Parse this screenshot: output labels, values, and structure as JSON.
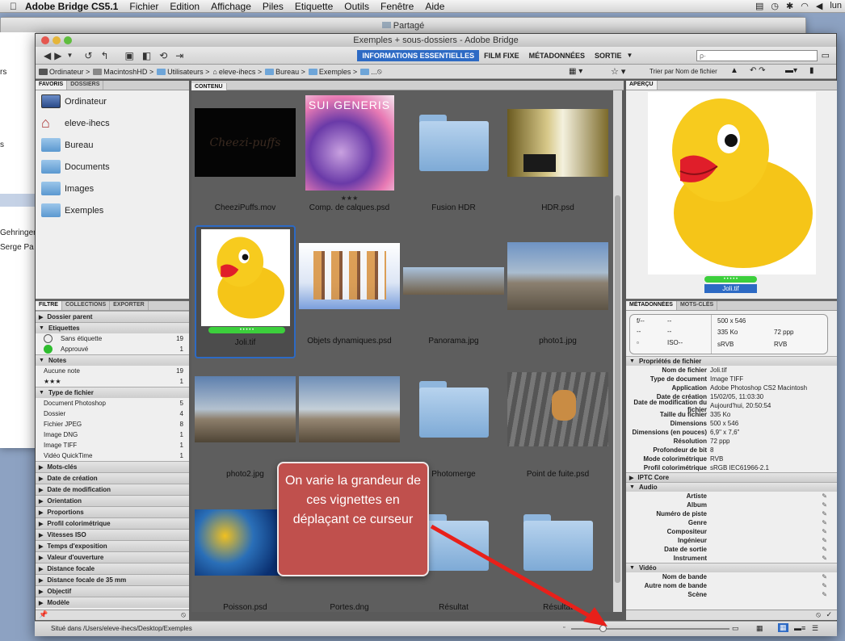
{
  "menubar": {
    "apple": "",
    "app": "Adobe Bridge CS5.1",
    "items": [
      "Fichier",
      "Edition",
      "Affichage",
      "Piles",
      "Etiquette",
      "Outils",
      "Fenêtre",
      "Aide"
    ],
    "clock": "lun"
  },
  "bg_window": {
    "title": "Partagé",
    "side_items": [
      "rs",
      "s"
    ],
    "names": [
      "Gehringer",
      "Serge Pa"
    ]
  },
  "window": {
    "title": "Exemples + sous-dossiers - Adobe Bridge"
  },
  "workspaces": [
    "INFORMATIONS ESSENTIELLES",
    "FILM FIXE",
    "MÉTADONNÉES",
    "SORTIE"
  ],
  "search": {
    "placeholder": "ρ·"
  },
  "path": [
    "Ordinateur",
    "MacintoshHD",
    "Utilisateurs",
    "eleve-ihecs",
    "Bureau",
    "Exemples",
    "..."
  ],
  "sort_label": "Trier par Nom de fichier",
  "fav_tabs": [
    "FAVORIS",
    "DOSSIERS"
  ],
  "favorites": [
    "Ordinateur",
    "eleve-ihecs",
    "Bureau",
    "Documents",
    "Images",
    "Exemples"
  ],
  "filter_tabs": [
    "FILTRE",
    "COLLECTIONS",
    "EXPORTER"
  ],
  "filter": {
    "parent": "Dossier parent",
    "etiquettes_head": "Etiquettes",
    "etiquettes": [
      {
        "label": "Sans étiquette",
        "count": "19"
      },
      {
        "label": "Approuvé",
        "count": "1"
      }
    ],
    "notes_head": "Notes",
    "notes": [
      {
        "label": "Aucune note",
        "count": "19"
      },
      {
        "label": "★★★",
        "count": "1"
      }
    ],
    "type_head": "Type de fichier",
    "types": [
      {
        "label": "Document Photoshop",
        "count": "5"
      },
      {
        "label": "Dossier",
        "count": "4"
      },
      {
        "label": "Fichier JPEG",
        "count": "8"
      },
      {
        "label": "Image DNG",
        "count": "1"
      },
      {
        "label": "Image TIFF",
        "count": "1"
      },
      {
        "label": "Vidéo QuickTime",
        "count": "1"
      }
    ],
    "collapsed": [
      "Mots-clés",
      "Date de création",
      "Date de modification",
      "Orientation",
      "Proportions",
      "Profil colorimétrique",
      "Vitesses ISO",
      "Temps d'exposition",
      "Valeur d'ouverture",
      "Distance focale",
      "Distance focale de 35 mm",
      "Objectif",
      "Modèle"
    ]
  },
  "content_tab": "CONTENU",
  "thumbs": [
    {
      "name": "CheeziPuffs.mov",
      "kind": "dark",
      "overlay": "Cheezi-puffs"
    },
    {
      "name": "Comp. de calques.psd",
      "kind": "art",
      "overlay": "SUI GENERIS",
      "stars": "★★★"
    },
    {
      "name": "Fusion HDR",
      "kind": "folder"
    },
    {
      "name": "HDR.psd",
      "kind": "room"
    },
    {
      "name": "Joli.tif",
      "kind": "duck",
      "selected": true,
      "label_dots": "• • • • •"
    },
    {
      "name": "Objets dynamiques.psd",
      "kind": "girls"
    },
    {
      "name": "Panorama.jpg",
      "kind": "pano"
    },
    {
      "name": "photo1.jpg",
      "kind": "city"
    },
    {
      "name": "photo2.jpg",
      "kind": "city2"
    },
    {
      "name": "",
      "kind": "city3"
    },
    {
      "name": "Photomerge",
      "kind": "folder"
    },
    {
      "name": "Point de fuite.psd",
      "kind": "dog"
    },
    {
      "name": "Poisson.psd",
      "kind": "fish"
    },
    {
      "name": "Portes.dng",
      "kind": "blank"
    },
    {
      "name": "Résultat",
      "kind": "folder"
    },
    {
      "name": "Résultat",
      "kind": "folder"
    }
  ],
  "preview_tab": "APERÇU",
  "preview_caption": "Joli.tif",
  "preview_dots": "• • • • •",
  "meta_tabs": [
    "MÉTADONNÉES",
    "MOTS-CLÉS"
  ],
  "meta_summary": {
    "f": "f/--",
    "a": "--",
    "b": "--",
    "c": "--",
    "iso": "ISO--",
    "dims": "500 x 546",
    "size": "335 Ko",
    "ppp": "72 ppp",
    "srvb": "sRVB",
    "rvb": "RVB"
  },
  "file_props_head": "Propriétés de fichier",
  "file_props": [
    {
      "k": "Nom de fichier",
      "v": "Joli.tif"
    },
    {
      "k": "Type de document",
      "v": "Image TIFF"
    },
    {
      "k": "Application",
      "v": "Adobe Photoshop CS2 Macintosh"
    },
    {
      "k": "Date de création",
      "v": "15/02/05, 11:03:30"
    },
    {
      "k": "Date de modification du fichier",
      "v": "Aujourd'hui, 20:50:54"
    },
    {
      "k": "Taille du fichier",
      "v": "335 Ko"
    },
    {
      "k": "Dimensions",
      "v": "500 x 546"
    },
    {
      "k": "Dimensions (en pouces)",
      "v": "6,9\" x 7,6\""
    },
    {
      "k": "Résolution",
      "v": "72 ppp"
    },
    {
      "k": "Profondeur de bit",
      "v": "8"
    },
    {
      "k": "Mode colorimétrique",
      "v": "RVB"
    },
    {
      "k": "Profil colorimétrique",
      "v": "sRGB IEC61966-2.1"
    }
  ],
  "iptc_head": "IPTC Core",
  "audio_head": "Audio",
  "audio": [
    "Artiste",
    "Album",
    "Numéro de piste",
    "Genre",
    "Compositeur",
    "Ingénieur",
    "Date de sortie",
    "Instrument"
  ],
  "video_head": "Vidéo",
  "video": [
    "Nom de bande",
    "Autre nom de bande",
    "Scène"
  ],
  "status": "Situé dans /Users/eleve-ihecs/Desktop/Exemples",
  "callout": "On varie la grandeur de ces vignettes en déplaçant ce curseur",
  "thumb_slider_value": 0.2,
  "colors": {
    "accent": "#2d6ac4",
    "callout": "#c0504d",
    "label_green": "#3ccf3c",
    "arrow": "#e8201a"
  }
}
